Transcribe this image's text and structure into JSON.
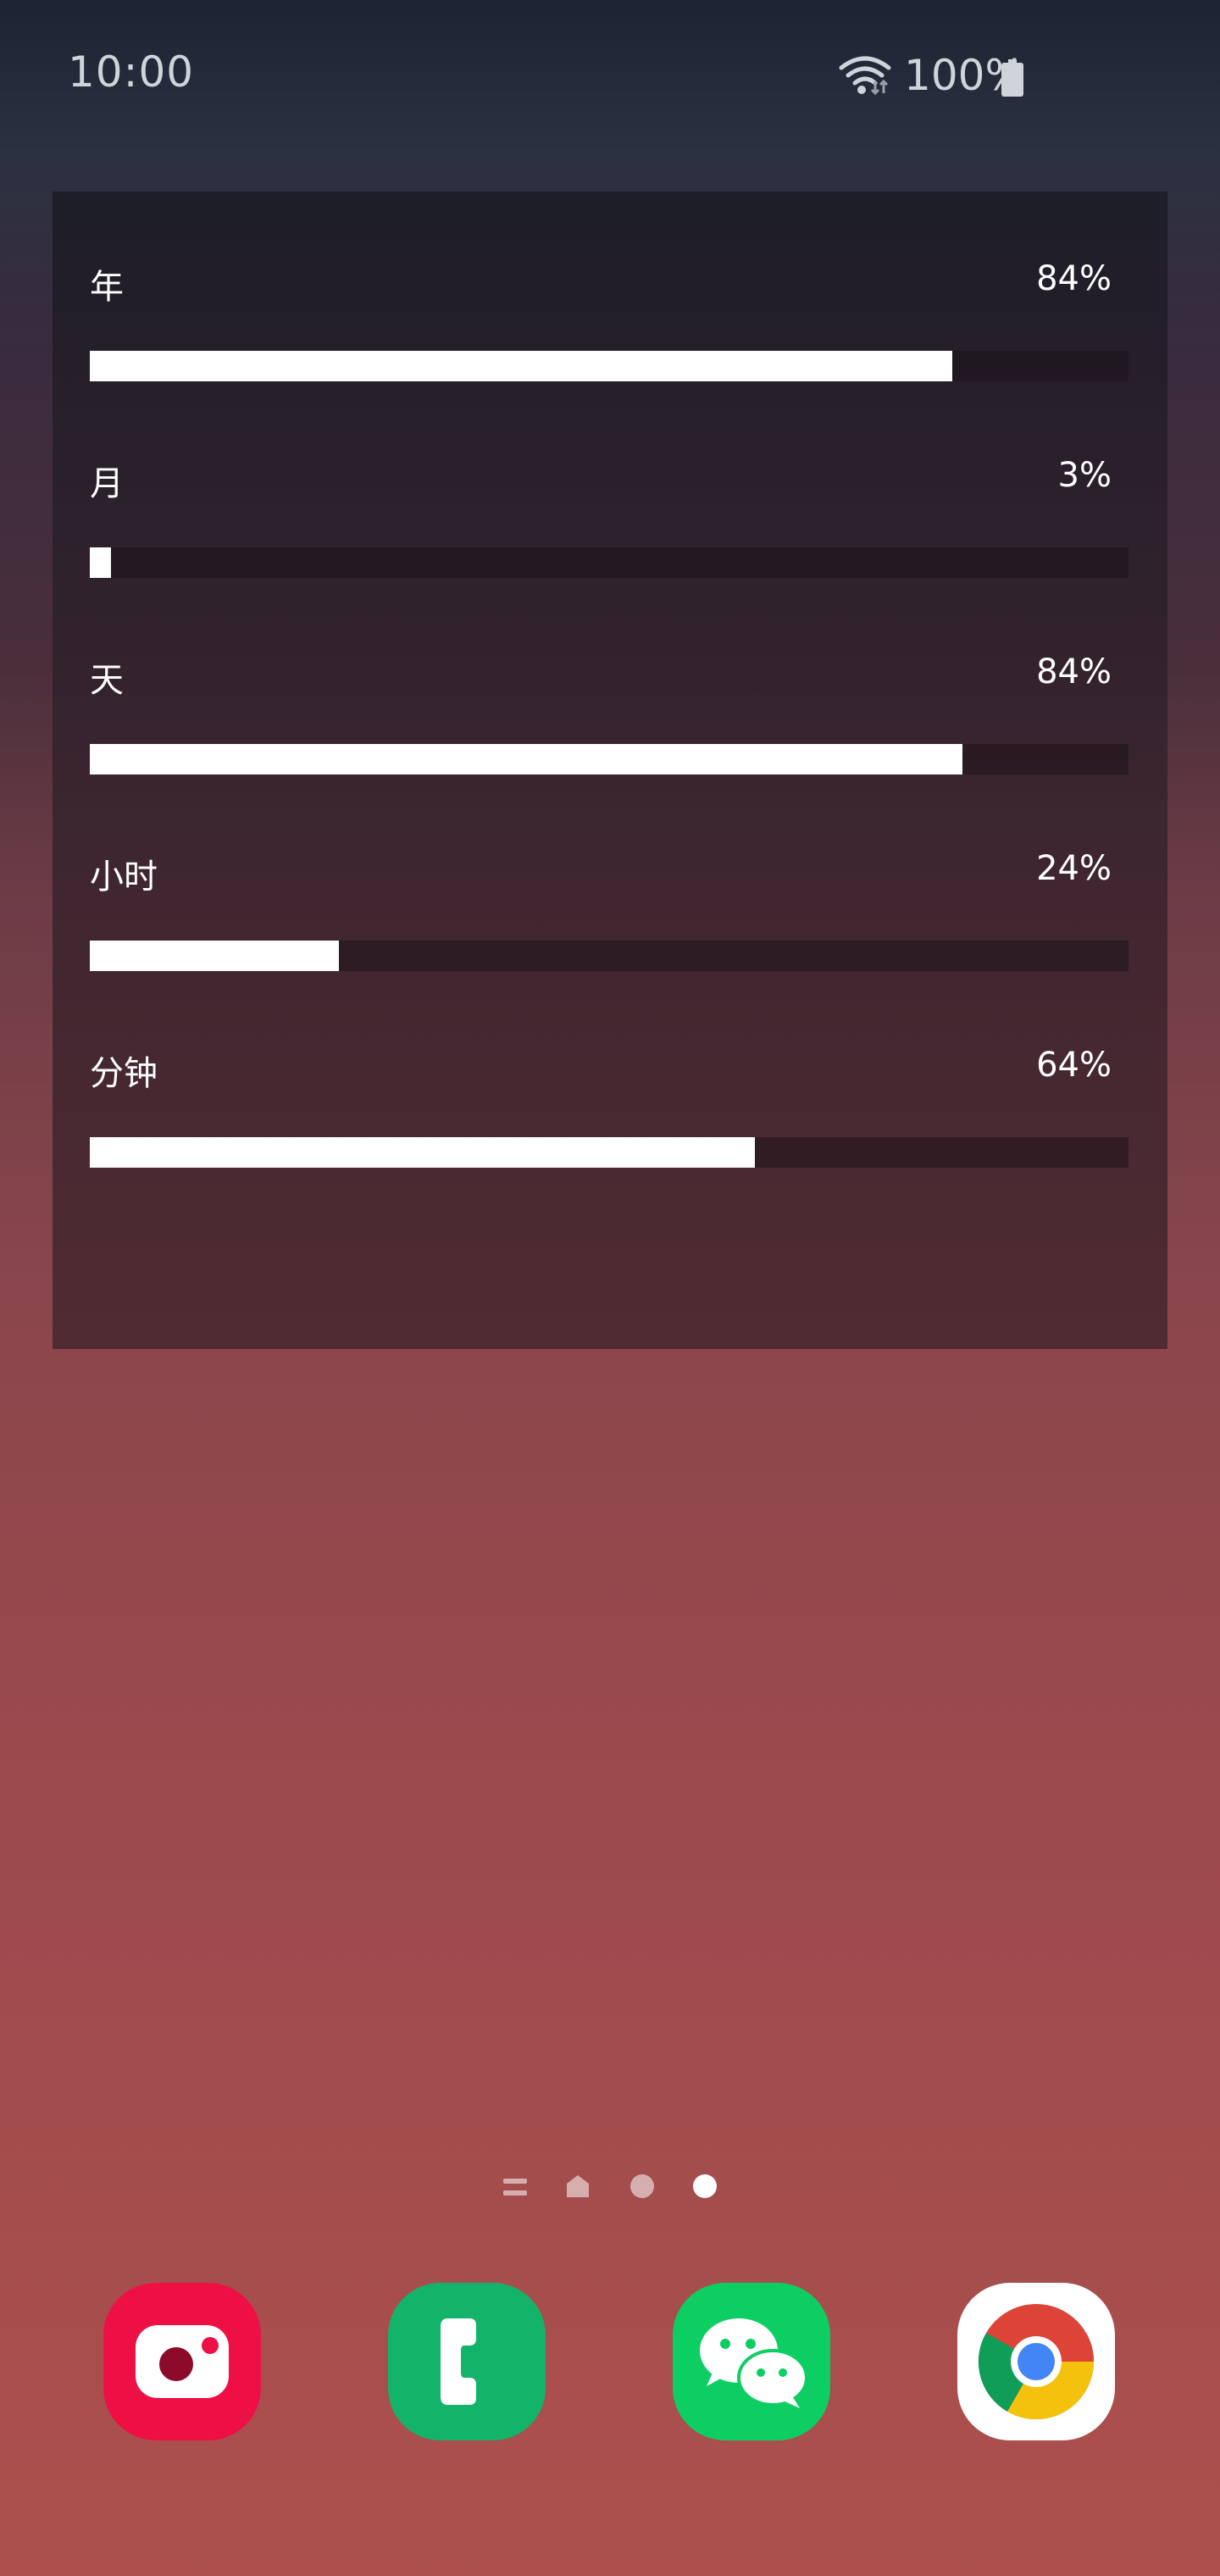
{
  "status_bar": {
    "time": "10:00",
    "battery": "100%"
  },
  "widget": {
    "rows": [
      {
        "label": "年",
        "percent": "84%",
        "fill": 0.83
      },
      {
        "label": "月",
        "percent": "3%",
        "fill": 0.02
      },
      {
        "label": "天",
        "percent": "84%",
        "fill": 0.84
      },
      {
        "label": "小时",
        "percent": "24%",
        "fill": 0.24
      },
      {
        "label": "分钟",
        "percent": "64%",
        "fill": 0.64
      }
    ]
  },
  "page_indicators": {
    "count": 4,
    "active_index": 3
  },
  "dock": {
    "apps": [
      {
        "name": "camera",
        "icon": "camera-icon",
        "color": "#ee1045"
      },
      {
        "name": "phone",
        "icon": "phone-icon",
        "color": "#13b46a"
      },
      {
        "name": "wechat",
        "icon": "wechat-icon",
        "color": "#0dce63"
      },
      {
        "name": "chrome",
        "icon": "chrome-icon",
        "color": "#ffffff"
      }
    ]
  }
}
